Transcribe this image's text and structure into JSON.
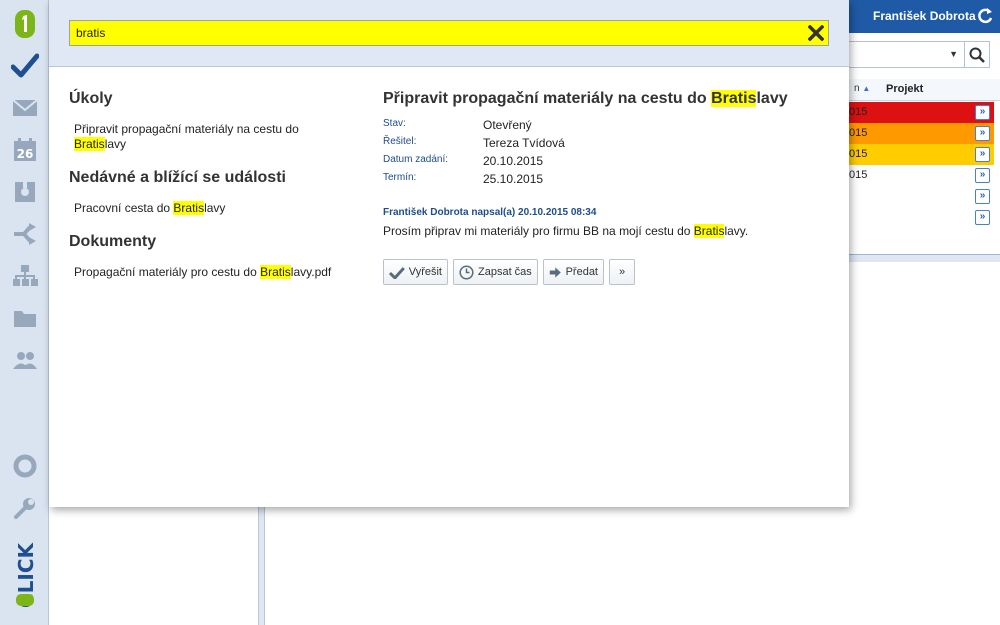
{
  "background_app": {
    "user_name": "František Dobrota",
    "table": {
      "col_partial": "n",
      "col_project": "Projekt",
      "rows": [
        {
          "text": "015",
          "color": "#dd1111"
        },
        {
          "text": "015",
          "color": "#ff9900"
        },
        {
          "text": "015",
          "color": "#ffcc00"
        },
        {
          "text": "015",
          "color": "#ffffff"
        },
        {
          "text": "",
          "color": "#ffffff"
        },
        {
          "text": "",
          "color": "#ffffff"
        }
      ],
      "row_button": "»"
    }
  },
  "search": {
    "query": "bratis"
  },
  "results": {
    "tasks_title": "Úkoly",
    "task_1": {
      "before": "Připravit propagační materiály na cestu do ",
      "highlight": "Bratis",
      "after": "lavy"
    },
    "events_title": "Nedávné a blížící se události",
    "event_1": {
      "before": "Pracovní cesta do ",
      "highlight": "Bratis",
      "after": "lavy"
    },
    "docs_title": "Dokumenty",
    "doc_1": {
      "before": "Propagační materiály pro cestu do ",
      "highlight": "Bratis",
      "after": "lavy.pdf"
    }
  },
  "detail": {
    "title": {
      "before": "Připravit propagační materiály na cestu do ",
      "highlight": "Bratis",
      "after": "lavy"
    },
    "status_label": "Stav:",
    "status_value": "Otevřený",
    "solver_label": "Řešitel:",
    "solver_value": "Tereza Tvídová",
    "assigned_label": "Datum zadání:",
    "assigned_value": "20.10.2015",
    "deadline_label": "Termín:",
    "deadline_value": "25.10.2015",
    "comment_author": "František Dobrota napsal(a) 20.10.2015 08:34",
    "comment": {
      "before": "Prosím připrav mi materiály pro firmu BB na mojí cestu do ",
      "highlight": "Bratis",
      "after": "lavy."
    },
    "actions": {
      "resolve": "Vyřešit",
      "log_time": "Zapsat čas",
      "forward": "Předat",
      "more": "»"
    }
  },
  "colors": {
    "highlight": "#ffff00",
    "accent": "#1f5aa6",
    "label": "#1e4c8c"
  }
}
